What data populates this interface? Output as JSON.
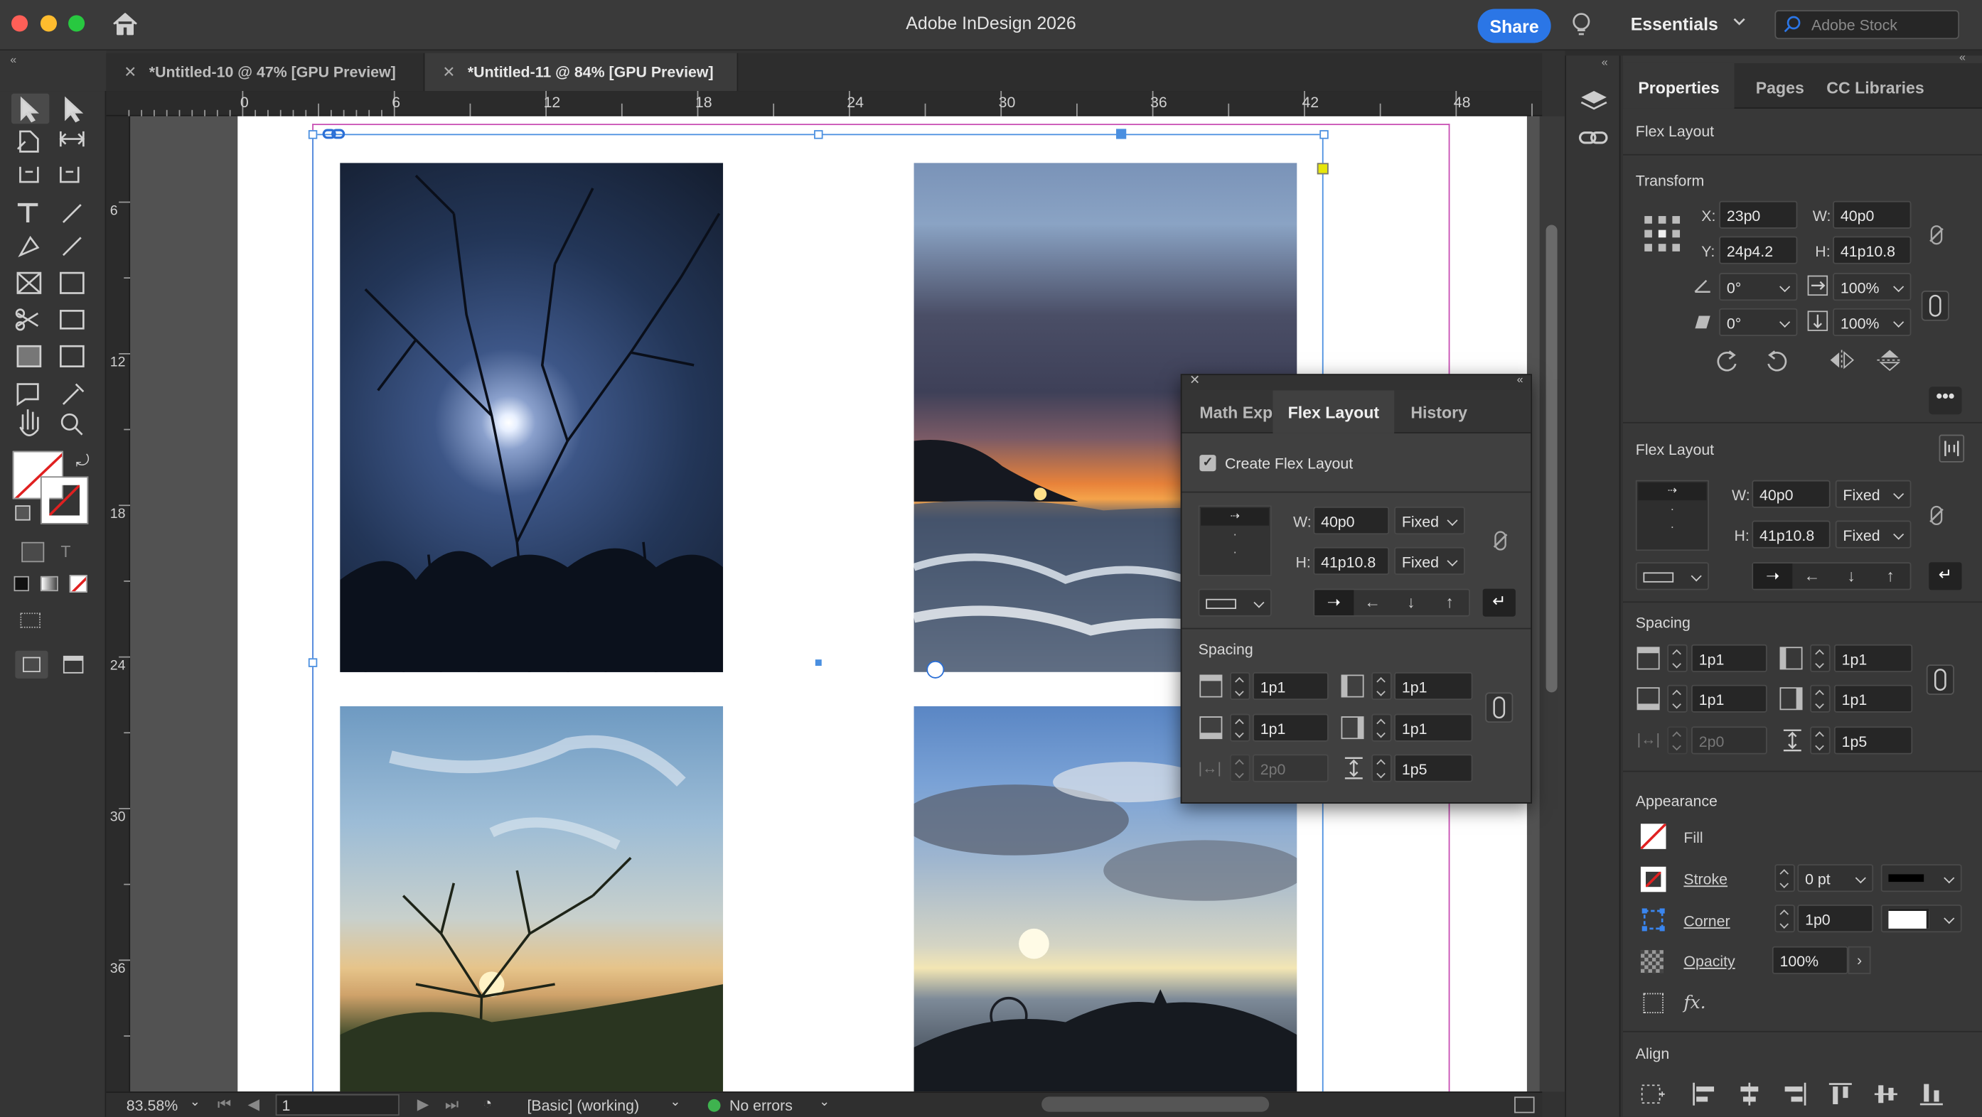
{
  "app": {
    "title": "Adobe InDesign 2026",
    "share_label": "Share",
    "workspace": "Essentials",
    "stock_placeholder": "Adobe Stock"
  },
  "doc_tabs": [
    {
      "label": "*Untitled-10 @ 47% [GPU Preview]",
      "active": false
    },
    {
      "label": "*Untitled-11 @ 84% [GPU Preview]",
      "active": true
    }
  ],
  "ruler": {
    "h": [
      "0",
      "6",
      "12",
      "18",
      "24",
      "30",
      "36",
      "42",
      "48"
    ],
    "v": [
      "6",
      "12",
      "18",
      "24",
      "30",
      "36"
    ]
  },
  "status": {
    "zoom": "83.58%",
    "page": "1",
    "style": "[Basic] (working)",
    "preflight": "No errors"
  },
  "right_panel": {
    "tabs": [
      "Properties",
      "Pages",
      "CC Libraries"
    ],
    "context": "Flex Layout",
    "transform": {
      "title": "Transform",
      "x_label": "X:",
      "x": "23p0",
      "y_label": "Y:",
      "y": "24p4.2",
      "w_label": "W:",
      "w": "40p0",
      "h_label": "H:",
      "h": "41p10.8",
      "rotate": "0°",
      "shear": "0°",
      "scale_x": "100%",
      "scale_y": "100%"
    },
    "flex": {
      "title": "Flex Layout",
      "w_label": "W:",
      "w": "40p0",
      "w_mode": "Fixed",
      "h_label": "H:",
      "h": "41p10.8",
      "h_mode": "Fixed"
    },
    "spacing": {
      "title": "Spacing",
      "top": "1p1",
      "left": "1p1",
      "bottom": "1p1",
      "right": "1p1",
      "gap": "2p0",
      "row_gap": "1p5"
    },
    "appearance": {
      "title": "Appearance",
      "fill": "Fill",
      "stroke": "Stroke",
      "stroke_weight": "0 pt",
      "corner": "Corner",
      "corner_size": "1p0",
      "opacity": "Opacity",
      "opacity_value": "100%"
    },
    "align": {
      "title": "Align"
    }
  },
  "float_panel": {
    "tabs": [
      "Math Exp",
      "Flex Layout",
      "History"
    ],
    "create_label": "Create Flex Layout",
    "w_label": "W:",
    "w": "40p0",
    "w_mode": "Fixed",
    "h_label": "H:",
    "h": "41p10.8",
    "h_mode": "Fixed",
    "spacing_title": "Spacing",
    "top": "1p1",
    "left": "1p1",
    "bottom": "1p1",
    "right": "1p1",
    "gap": "2p0",
    "row_gap": "1p5"
  },
  "colors": {
    "accent": "#2b76e6",
    "frame": "#4a8fe0",
    "margin": "#c84db3"
  }
}
